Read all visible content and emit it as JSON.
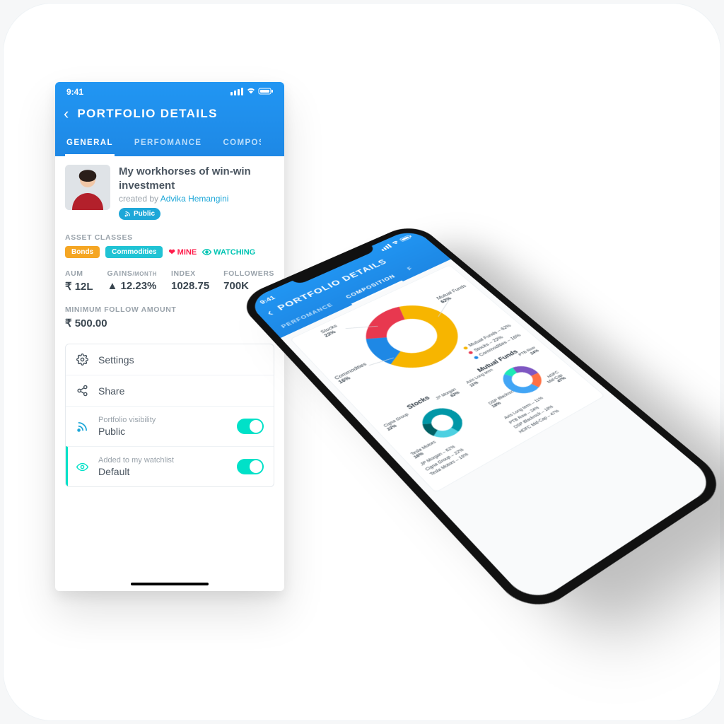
{
  "status_time": "9:41",
  "screen_title": "PORTFOLIO DETAILS",
  "tabs": [
    "GENERAL",
    "PERFOMANCE",
    "COMPOSITION"
  ],
  "active_tab_flat": "GENERAL",
  "active_tab_iso": "COMPOSITION",
  "portfolio": {
    "name": "My workhorses of win-win investment",
    "created_prefix": "created by",
    "author": "Advika  Hemangini",
    "visibility_badge": "Public"
  },
  "asset_classes_label": "ASSET CLASSES",
  "chips": {
    "bonds": "Bonds",
    "commodities": "Commodities",
    "mine": "MINE",
    "watching": "WATCHING"
  },
  "stats": {
    "aum": {
      "label": "AUM",
      "value": "₹ 12L"
    },
    "gains": {
      "label": "GAINS",
      "sub": "/MONTH",
      "value": "12.23%",
      "arrow": "▲"
    },
    "index": {
      "label": "INDEX",
      "value": "1028.75"
    },
    "followers": {
      "label": "FOLLOWERS",
      "value": "700K"
    }
  },
  "min_follow": {
    "label": "MINIMUM FOLLOW AMOUNT",
    "value": "₹ 500.00"
  },
  "rows": {
    "settings": "Settings",
    "share": "Share",
    "visibility": {
      "caption": "Portfolio visibility",
      "value": "Public"
    },
    "watchlist": {
      "caption": "Added to my watchlist",
      "value": "Default"
    }
  },
  "chart_data": [
    {
      "type": "pie",
      "title": "",
      "series": [
        {
          "name": "Mutual Funds",
          "value": 62,
          "color": "#f7b500"
        },
        {
          "name": "Stocks",
          "value": 22,
          "color": "#e8384f"
        },
        {
          "name": "Commodities",
          "value": 16,
          "color": "#1e88e5"
        }
      ],
      "annotations": {
        "Stocks": "22%",
        "Mutual Funds": "62%",
        "Commodities": "16%"
      },
      "legend": [
        "Mutual Funds – 62%",
        "Stocks – 22%",
        "Commodities – 16%"
      ]
    },
    {
      "type": "pie",
      "title": "Stocks",
      "series": [
        {
          "name": "JP Morgan",
          "value": 62,
          "color": "#0097a7"
        },
        {
          "name": "Cigna Group",
          "value": 22,
          "color": "#4dd0e1"
        },
        {
          "name": "Tesla Motors",
          "value": 16,
          "color": "#006064"
        }
      ],
      "annotations": {
        "JP Morgan": "62%",
        "Cigna Group": "22%",
        "Tesla Motors": "16%"
      },
      "legend": [
        "JP Morgan – 62%",
        "Cigna Group – 22%",
        "Tesla Motors – 16%"
      ]
    },
    {
      "type": "pie",
      "title": "Mutual Funds",
      "series": [
        {
          "name": "Axis Long term",
          "value": 11,
          "color": "#1de9b6"
        },
        {
          "name": "PTB Row",
          "value": 24,
          "color": "#7e57c2"
        },
        {
          "name": "DSP Blackrock",
          "value": 18,
          "color": "#ff7043"
        },
        {
          "name": "HDFC Mid-Cap",
          "value": 47,
          "color": "#42a5f5"
        }
      ],
      "annotations": {
        "Axis Long term": "11%",
        "PTB Row": "24%",
        "DSP Blackrock": "18%",
        "HDFC Mid-Cap": "47%"
      },
      "legend": [
        "Axis Long term – 11%",
        "PTB Row – 24%",
        "DSP Blackrock – 18%",
        "HDFC Mid-Cap – 47%"
      ]
    }
  ]
}
